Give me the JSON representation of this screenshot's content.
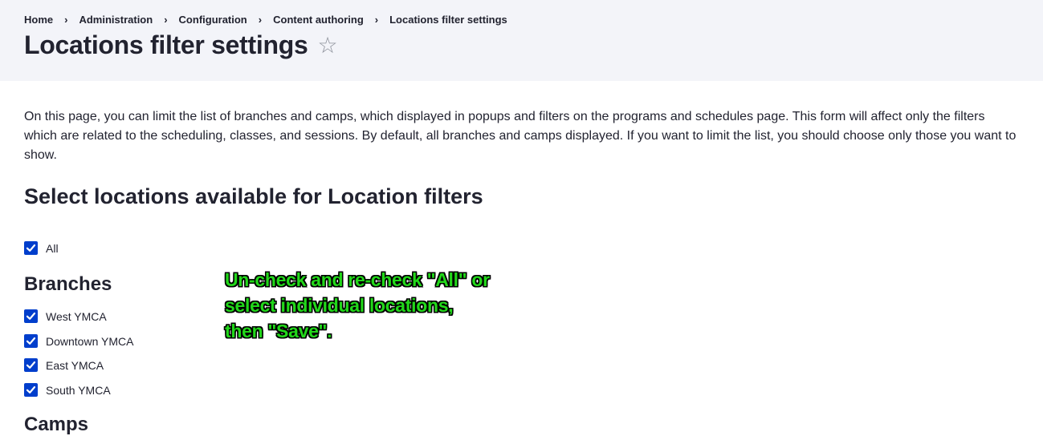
{
  "breadcrumb": {
    "items": [
      "Home",
      "Administration",
      "Configuration",
      "Content authoring",
      "Locations filter settings"
    ],
    "separator": "›"
  },
  "page": {
    "title": "Locations filter settings",
    "star_glyph": "☆"
  },
  "intro": "On this page, you can limit the list of branches and camps, which displayed in popups and filters on the programs and schedules page. This form will affect only the filters which are related to the scheduling, classes, and sessions. By default, all branches and camps displayed. If you want to limit the list, you should choose only those you want to show.",
  "form": {
    "heading": "Select locations available for Location filters",
    "all": {
      "label": "All",
      "checked": true
    },
    "branches": {
      "heading": "Branches",
      "items": [
        {
          "label": "West YMCA",
          "checked": true
        },
        {
          "label": "Downtown YMCA",
          "checked": true
        },
        {
          "label": "East YMCA",
          "checked": true
        },
        {
          "label": "South YMCA",
          "checked": true
        }
      ]
    },
    "camps": {
      "heading": "Camps"
    }
  },
  "annotation": {
    "text": "Un-check and re-check \"All\" or\nselect individual locations,\nthen \"Save\"."
  },
  "colors": {
    "header_bg": "#f3f4f9",
    "checkbox": "#003ecc",
    "annotation_text": "#22d81a",
    "text": "#222330"
  }
}
